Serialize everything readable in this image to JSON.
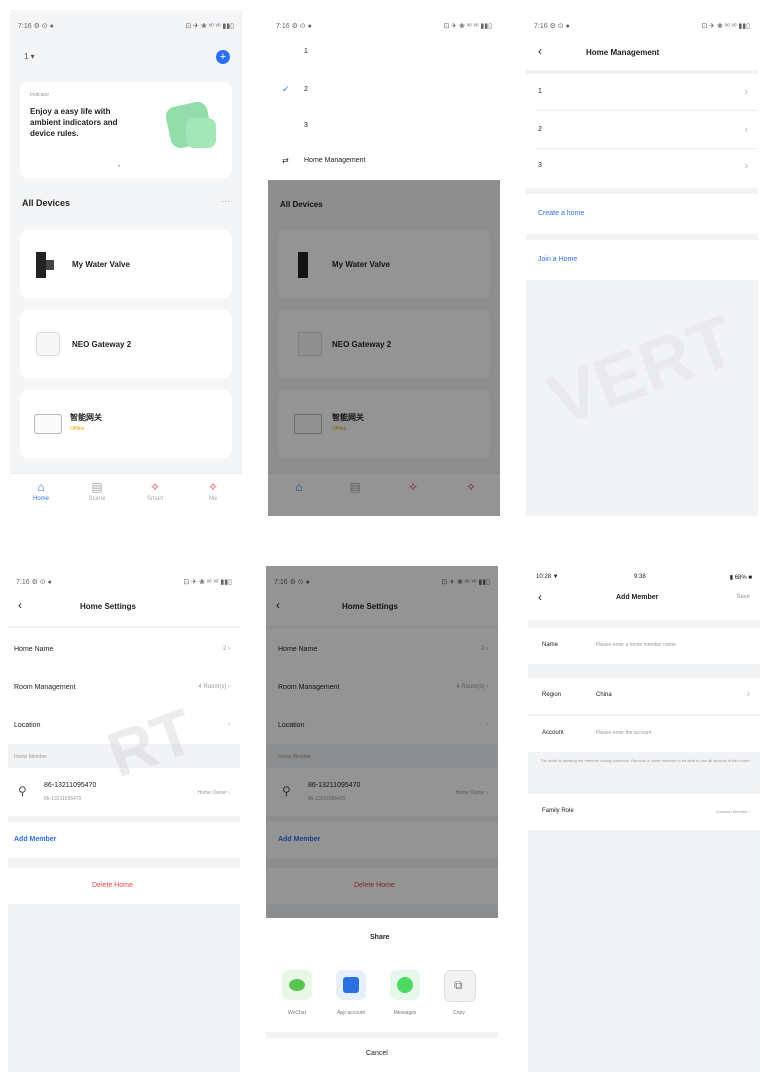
{
  "colors": {
    "accent": "#2d6ff2",
    "danger": "#e04848",
    "bg": "#f2f3f5",
    "wechat": "#5ac452",
    "messages": "#4cd964",
    "app_blue": "#2b6fe0"
  },
  "status": {
    "left": "7:16 ⚙ ⊙ ●",
    "right": "⊡ ✈ ❀ ᵛᵒ ᵛᵒ ▮▮▯",
    "ios_time": "10:28 ▼",
    "ios_center": "9:38",
    "ios_right": "▮ 68% ■"
  },
  "s1": {
    "home_name": "1 ▾",
    "banner_small": "Indicator",
    "banner_text": "Enjoy a easy life with ambient indicators and device rules.",
    "all_devices": "All Devices",
    "more": "···",
    "devices": [
      {
        "name": "My Water Valve",
        "sub": ""
      },
      {
        "name": "NEO Gateway 2",
        "sub": ""
      },
      {
        "name": "智能网关",
        "sub": "Offline"
      }
    ],
    "tabs": [
      "Home",
      "Scene",
      "Smart",
      "Me"
    ]
  },
  "s2": {
    "homes": [
      "1",
      "2",
      "3"
    ],
    "home_management": "Home Management",
    "all_devices": "All Devices",
    "devices": [
      "My Water Valve",
      "NEO Gateway 2",
      "智能网关"
    ],
    "device3_sub": "Offline"
  },
  "s3": {
    "title": "Home Management",
    "homes": [
      "1",
      "2",
      "3"
    ],
    "create_home": "Create a home",
    "join_home": "Join a Home",
    "watermark": "VERT"
  },
  "s4": {
    "title": "Home Settings",
    "rows": [
      {
        "label": "Home Name",
        "value": "2 ›"
      },
      {
        "label": "Room Management",
        "value": "4 Room(s) ›"
      },
      {
        "label": "Location",
        "value": "›"
      }
    ],
    "section": "Home Member",
    "member_name": "86-13211095470",
    "member_sub": "86-13211095470",
    "member_role": "Home Owner ›",
    "add_member": "Add Member",
    "delete_home": "Delete Home",
    "watermark": "RT"
  },
  "s5": {
    "title": "Home Settings",
    "rows": [
      {
        "label": "Home Name",
        "value": "2 ›"
      },
      {
        "label": "Room Management",
        "value": "4 Room(s) ›"
      },
      {
        "label": "Location",
        "value": "›"
      }
    ],
    "section": "Home Member",
    "member_name": "86-13211095470",
    "member_sub": "86-13211095470",
    "member_role": "Home Owner ›",
    "add_member": "Add Member",
    "delete_home": "Delete Home",
    "share_title": "Share",
    "share_items": [
      "WeChat",
      "App account",
      "Messages",
      "Copy"
    ],
    "cancel": "Cancel"
  },
  "s6": {
    "title": "Add Member",
    "save": "Save",
    "name_label": "Name",
    "name_placeholder": "Please enter a home member name",
    "region_label": "Region",
    "region_value": "China",
    "account_label": "Account",
    "account_placeholder": "Please enter the account",
    "note": "The invite is pending the member during tomorrow. Records a home member to be able to use all devices in this home.",
    "family_role_label": "Family Role",
    "family_role_value": "Common Member ›"
  }
}
